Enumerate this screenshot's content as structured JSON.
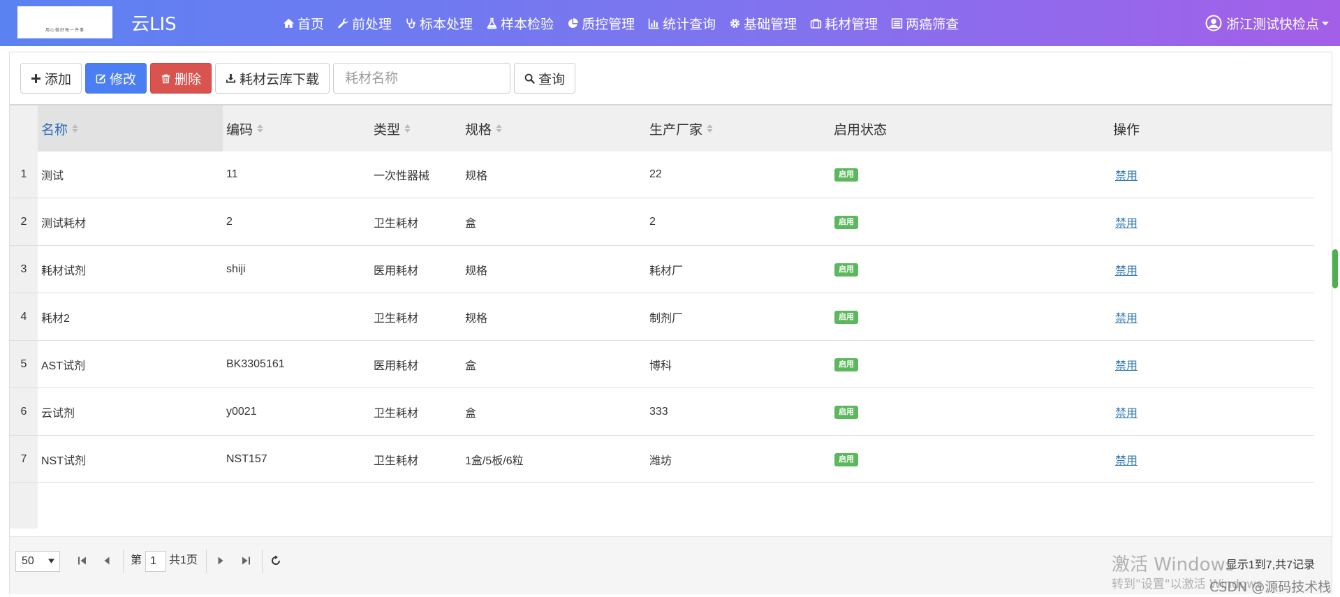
{
  "header": {
    "logo_caption": "用心做好每一件事",
    "brand": "云LIS",
    "nav": [
      {
        "label": "首页",
        "icon": "home-icon"
      },
      {
        "label": "前处理",
        "icon": "wrench-icon"
      },
      {
        "label": "标本处理",
        "icon": "stethoscope-icon"
      },
      {
        "label": "样本检验",
        "icon": "flask-icon"
      },
      {
        "label": "质控管理",
        "icon": "pie-chart-icon"
      },
      {
        "label": "统计查询",
        "icon": "bar-chart-icon"
      },
      {
        "label": "基础管理",
        "icon": "gear-icon"
      },
      {
        "label": "耗材管理",
        "icon": "briefcase-icon"
      },
      {
        "label": "两癌筛查",
        "icon": "list-icon"
      }
    ],
    "user": "浙江测试快检点"
  },
  "toolbar": {
    "add_label": "添加",
    "edit_label": "修改",
    "delete_label": "删除",
    "download_label": "耗材云库下载",
    "search_placeholder": "耗材名称",
    "query_label": "查询"
  },
  "table": {
    "columns": [
      "名称",
      "编码",
      "类型",
      "规格",
      "生产厂家",
      "启用状态",
      "操作"
    ],
    "rows": [
      {
        "num": "1",
        "name": "测试",
        "code": "11",
        "type": "一次性器械",
        "spec": "规格",
        "maker": "22",
        "status": "启用",
        "action": "禁用"
      },
      {
        "num": "2",
        "name": "测试耗材",
        "code": "2",
        "type": "卫生耗材",
        "spec": "盒",
        "maker": "2",
        "status": "启用",
        "action": "禁用"
      },
      {
        "num": "3",
        "name": "耗材试剂",
        "code": "shiji",
        "type": "医用耗材",
        "spec": "规格",
        "maker": "耗材厂",
        "status": "启用",
        "action": "禁用"
      },
      {
        "num": "4",
        "name": "耗材2",
        "code": "",
        "type": "卫生耗材",
        "spec": "规格",
        "maker": "制剂厂",
        "status": "启用",
        "action": "禁用"
      },
      {
        "num": "5",
        "name": "AST试剂",
        "code": "BK3305161",
        "type": "医用耗材",
        "spec": "盒",
        "maker": "博科",
        "status": "启用",
        "action": "禁用"
      },
      {
        "num": "6",
        "name": "云试剂",
        "code": "y0021",
        "type": "卫生耗材",
        "spec": "盒",
        "maker": "333",
        "status": "启用",
        "action": "禁用"
      },
      {
        "num": "7",
        "name": "NST试剂",
        "code": "NST157",
        "type": "卫生耗材",
        "spec": "1盒/5板/6粒",
        "maker": "潍坊",
        "status": "启用",
        "action": "禁用"
      }
    ]
  },
  "pagination": {
    "page_size": "50",
    "page_prefix": "第",
    "current_page": "1",
    "total_pages": "共1页",
    "record_info": "显示1到7,共7记录"
  },
  "watermark": {
    "line1": "激活 Windows",
    "line2": "转到\"设置\"以激活 Windows",
    "credit": "CSDN @源码技术栈"
  },
  "colors": {
    "header_start": "#5b82f2",
    "header_end": "#a35fe8",
    "primary": "#4b7ef3",
    "danger": "#d9534f",
    "success": "#5cb85c",
    "link": "#337ab7"
  }
}
